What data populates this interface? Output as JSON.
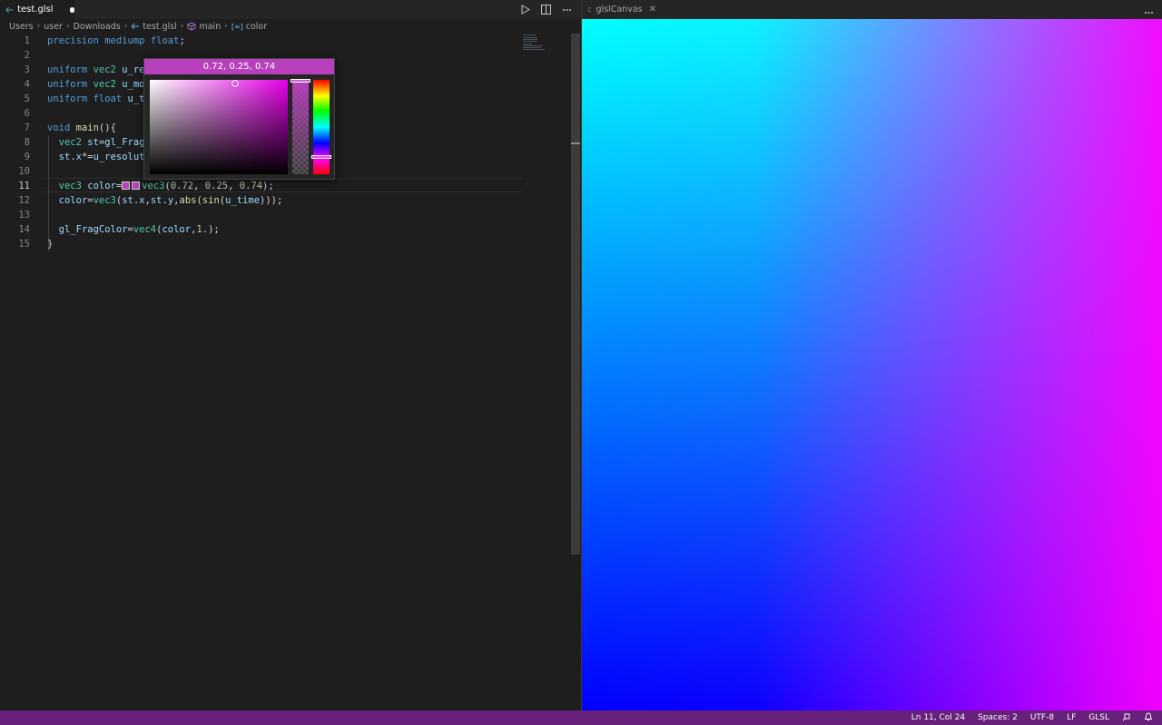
{
  "editor": {
    "tab": {
      "name": "test.glsl",
      "dirty": true
    },
    "actions": [
      "run-icon",
      "split-editor-icon",
      "more-actions-icon"
    ],
    "breadcrumb": [
      "Users",
      "user",
      "Downloads",
      "test.glsl",
      "main",
      "color"
    ],
    "lines": [
      {
        "n": "1",
        "tokens": [
          [
            "kw",
            "precision"
          ],
          [
            "plain",
            " "
          ],
          [
            "kw",
            "mediump"
          ],
          [
            "plain",
            " "
          ],
          [
            "kw",
            "float"
          ],
          [
            "plain",
            ";"
          ]
        ]
      },
      {
        "n": "2",
        "tokens": []
      },
      {
        "n": "3",
        "tokens": [
          [
            "kw",
            "uniform"
          ],
          [
            "plain",
            " "
          ],
          [
            "type",
            "vec2"
          ],
          [
            "plain",
            " "
          ],
          [
            "var",
            "u_re"
          ]
        ]
      },
      {
        "n": "4",
        "tokens": [
          [
            "kw",
            "uniform"
          ],
          [
            "plain",
            " "
          ],
          [
            "type",
            "vec2"
          ],
          [
            "plain",
            " "
          ],
          [
            "var",
            "u_mo"
          ]
        ]
      },
      {
        "n": "5",
        "tokens": [
          [
            "kw",
            "uniform"
          ],
          [
            "plain",
            " "
          ],
          [
            "kw",
            "float"
          ],
          [
            "plain",
            " "
          ],
          [
            "var",
            "u_t"
          ]
        ]
      },
      {
        "n": "6",
        "tokens": []
      },
      {
        "n": "7",
        "tokens": [
          [
            "kw",
            "void"
          ],
          [
            "plain",
            " "
          ],
          [
            "fn",
            "main"
          ],
          [
            "plain",
            "(){"
          ]
        ]
      },
      {
        "n": "8",
        "tokens": [
          [
            "plain",
            "  "
          ],
          [
            "type",
            "vec2"
          ],
          [
            "plain",
            " "
          ],
          [
            "var",
            "st"
          ],
          [
            "plain",
            "="
          ],
          [
            "var",
            "gl_Frag"
          ]
        ]
      },
      {
        "n": "9",
        "tokens": [
          [
            "plain",
            "  "
          ],
          [
            "var",
            "st"
          ],
          [
            "plain",
            "."
          ],
          [
            "var",
            "x"
          ],
          [
            "plain",
            "*="
          ],
          [
            "var",
            "u_resolut"
          ]
        ]
      },
      {
        "n": "10",
        "tokens": []
      },
      {
        "n": "11",
        "tokens": [
          [
            "plain",
            "  "
          ],
          [
            "type",
            "vec3"
          ],
          [
            "plain",
            " "
          ],
          [
            "var",
            "color"
          ],
          [
            "plain",
            "="
          ],
          [
            "swatch",
            ""
          ],
          [
            "swatch",
            ""
          ],
          [
            "type",
            "vec3"
          ],
          [
            "plain",
            "("
          ],
          [
            "num",
            "0.72"
          ],
          [
            "plain",
            ", "
          ],
          [
            "num",
            "0.25"
          ],
          [
            "plain",
            ", "
          ],
          [
            "num",
            "0.74"
          ],
          [
            "plain",
            ");"
          ]
        ]
      },
      {
        "n": "12",
        "tokens": [
          [
            "plain",
            "  "
          ],
          [
            "var",
            "color"
          ],
          [
            "plain",
            "="
          ],
          [
            "type",
            "vec3"
          ],
          [
            "plain",
            "("
          ],
          [
            "var",
            "st"
          ],
          [
            "plain",
            "."
          ],
          [
            "var",
            "x"
          ],
          [
            "plain",
            ","
          ],
          [
            "var",
            "st"
          ],
          [
            "plain",
            "."
          ],
          [
            "var",
            "y"
          ],
          [
            "plain",
            ","
          ],
          [
            "fn",
            "abs"
          ],
          [
            "plain",
            "("
          ],
          [
            "fn",
            "sin"
          ],
          [
            "plain",
            "("
          ],
          [
            "var",
            "u_time"
          ],
          [
            "plain",
            ")));"
          ]
        ]
      },
      {
        "n": "13",
        "tokens": []
      },
      {
        "n": "14",
        "tokens": [
          [
            "plain",
            "  "
          ],
          [
            "var",
            "gl_FragColor"
          ],
          [
            "plain",
            "="
          ],
          [
            "type",
            "vec4"
          ],
          [
            "plain",
            "("
          ],
          [
            "var",
            "color"
          ],
          [
            "plain",
            ","
          ],
          [
            "num",
            "1."
          ],
          [
            "plain",
            ");"
          ]
        ]
      },
      {
        "n": "15",
        "tokens": [
          [
            "plain",
            "}"
          ]
        ]
      }
    ],
    "current_line": "11"
  },
  "color_picker": {
    "value": "0.72, 0.25, 0.74",
    "color": "#b840bd"
  },
  "right_panel": {
    "tab_name": "glslCanvas",
    "close_icon": "close-icon"
  },
  "status_bar": {
    "position": "Ln 11, Col 24",
    "spaces": "Spaces: 2",
    "encoding": "UTF-8",
    "eol": "LF",
    "language": "GLSL"
  },
  "colors": {
    "status_bar": "#68217a",
    "accent": "#b840bd",
    "background": "#1e1e1e"
  }
}
